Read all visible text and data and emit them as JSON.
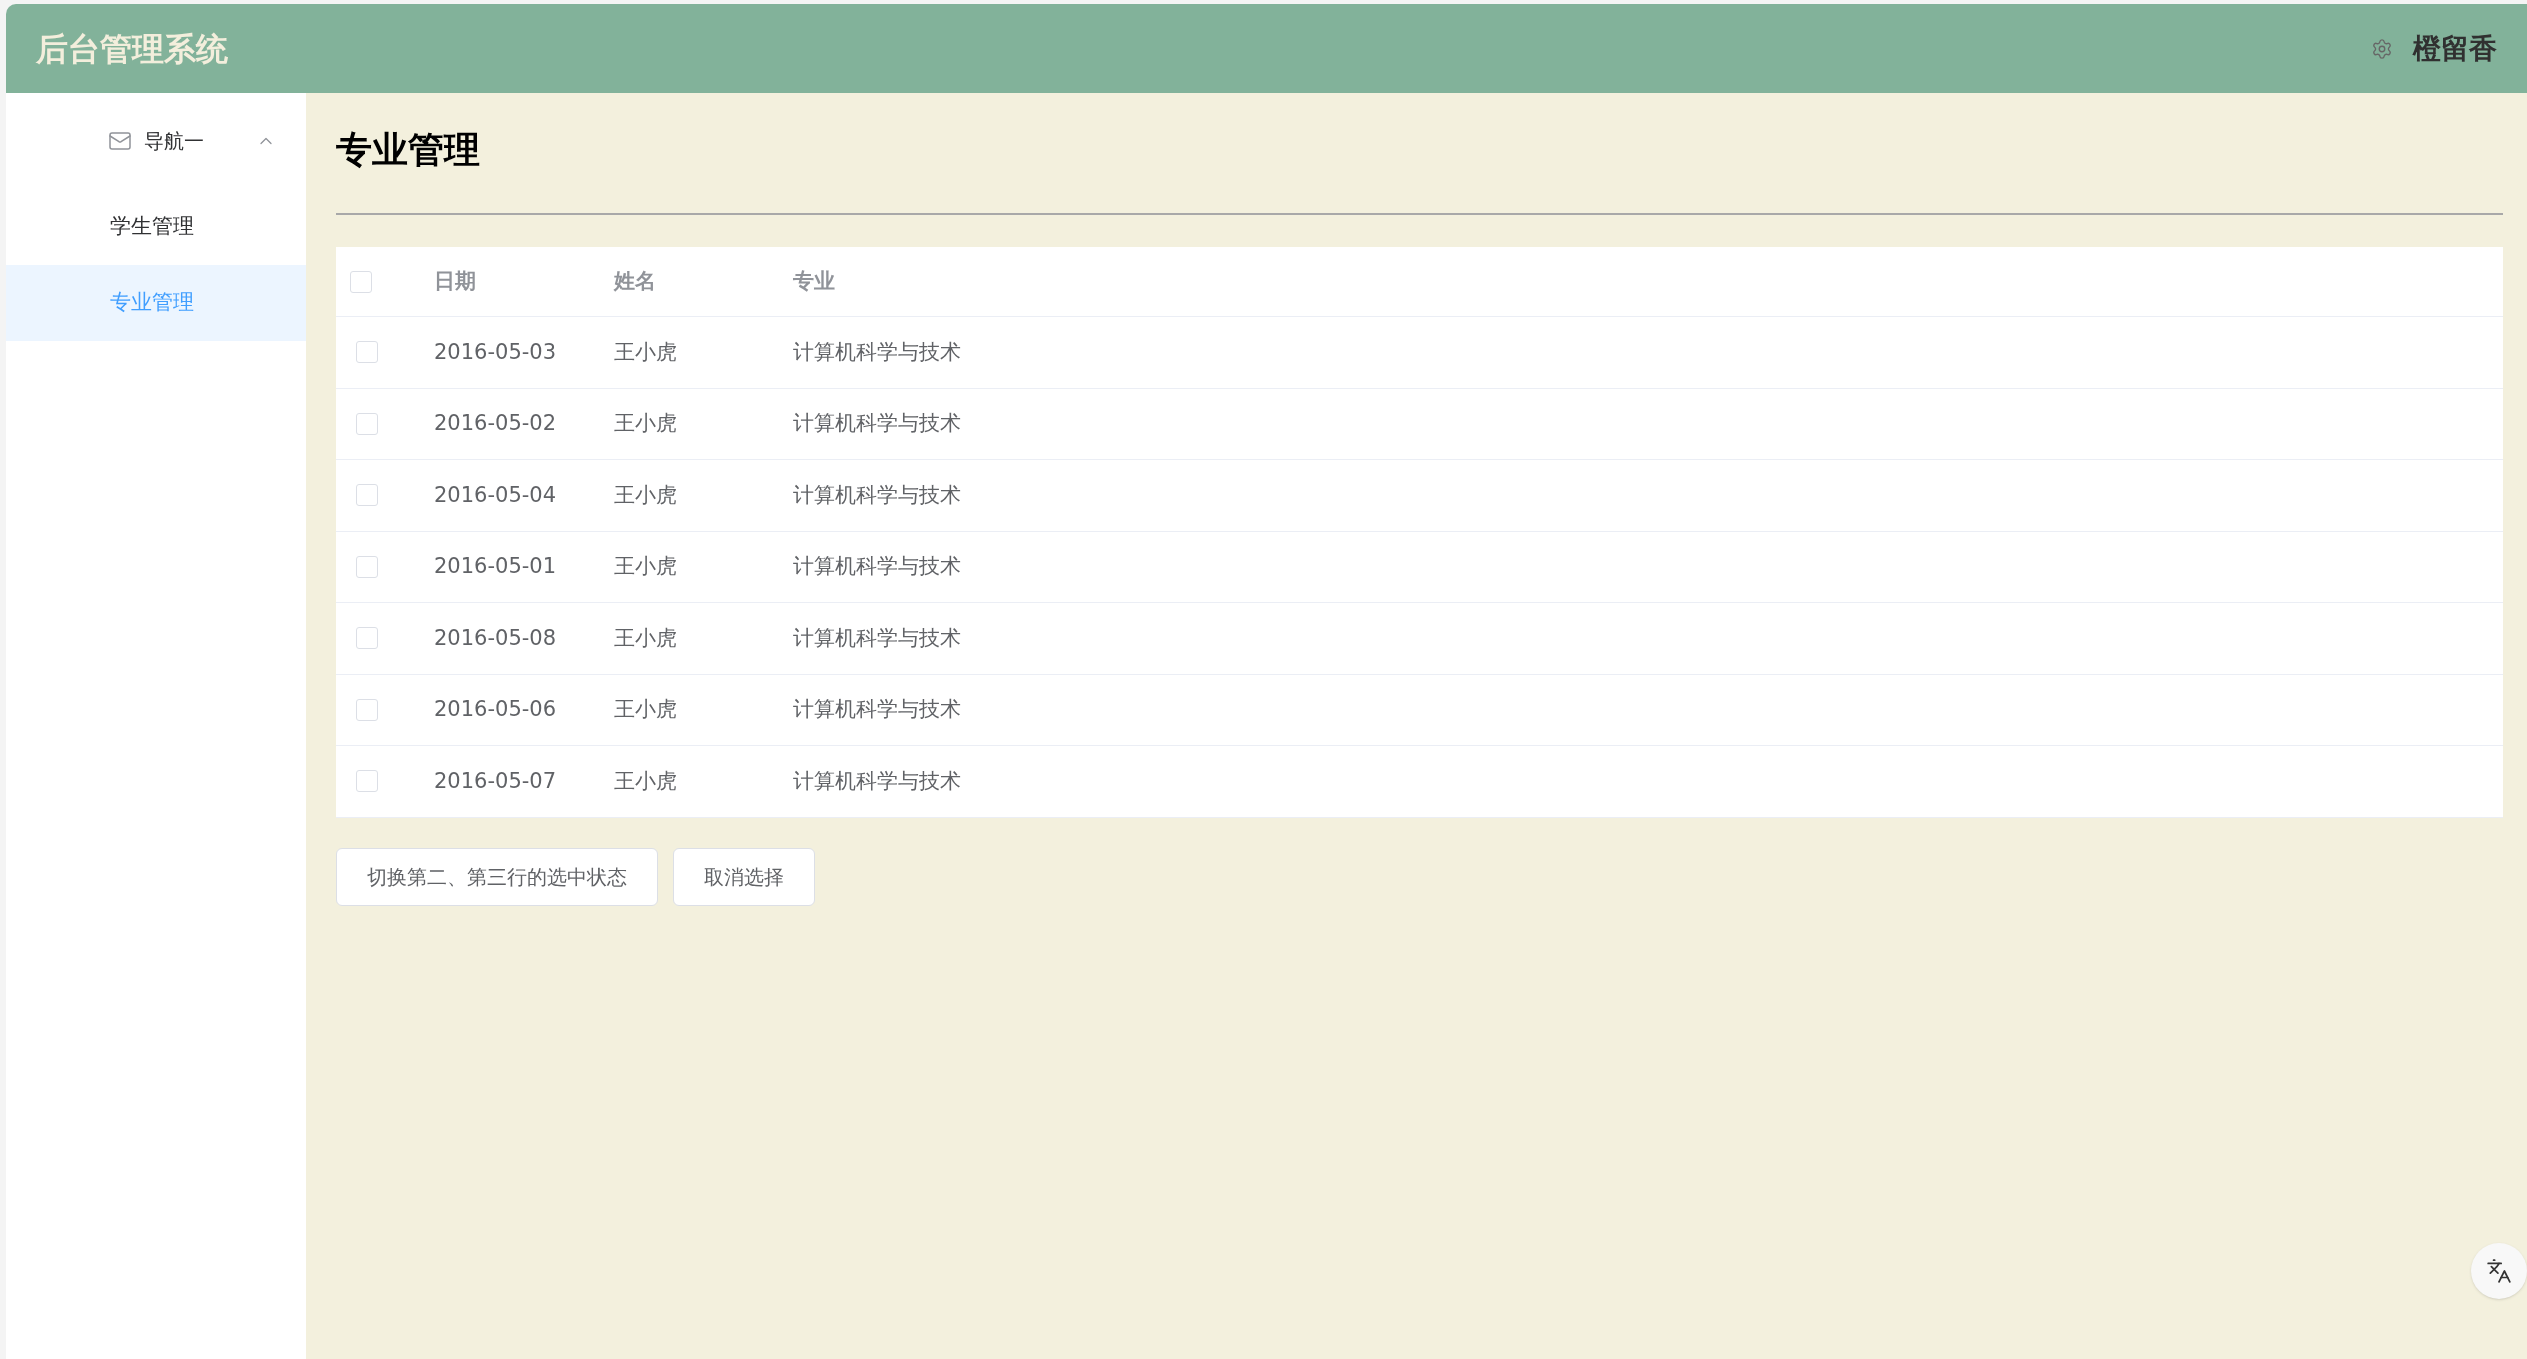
{
  "header": {
    "title": "后台管理系统",
    "user": "橙留香"
  },
  "sidebar": {
    "group": {
      "label": "导航一",
      "expanded": true
    },
    "items": [
      {
        "label": "学生管理",
        "selected": false
      },
      {
        "label": "专业管理",
        "selected": true
      }
    ]
  },
  "page_title": "专业管理",
  "table": {
    "select_all": {
      "checked": false
    },
    "columns": [
      "日期",
      "姓名",
      "专业"
    ],
    "rows": [
      {
        "checked": false,
        "cells": [
          "2016-05-03",
          "王小虎",
          "计算机科学与技术"
        ]
      },
      {
        "checked": false,
        "cells": [
          "2016-05-02",
          "王小虎",
          "计算机科学与技术"
        ]
      },
      {
        "checked": false,
        "cells": [
          "2016-05-04",
          "王小虎",
          "计算机科学与技术"
        ]
      },
      {
        "checked": false,
        "cells": [
          "2016-05-01",
          "王小虎",
          "计算机科学与技术"
        ]
      },
      {
        "checked": false,
        "cells": [
          "2016-05-08",
          "王小虎",
          "计算机科学与技术"
        ]
      },
      {
        "checked": false,
        "cells": [
          "2016-05-06",
          "王小虎",
          "计算机科学与技术"
        ]
      },
      {
        "checked": false,
        "cells": [
          "2016-05-07",
          "王小虎",
          "计算机科学与技术"
        ]
      }
    ]
  },
  "buttons": [
    "切换第二、第三行的选中状态",
    "取消选择"
  ]
}
